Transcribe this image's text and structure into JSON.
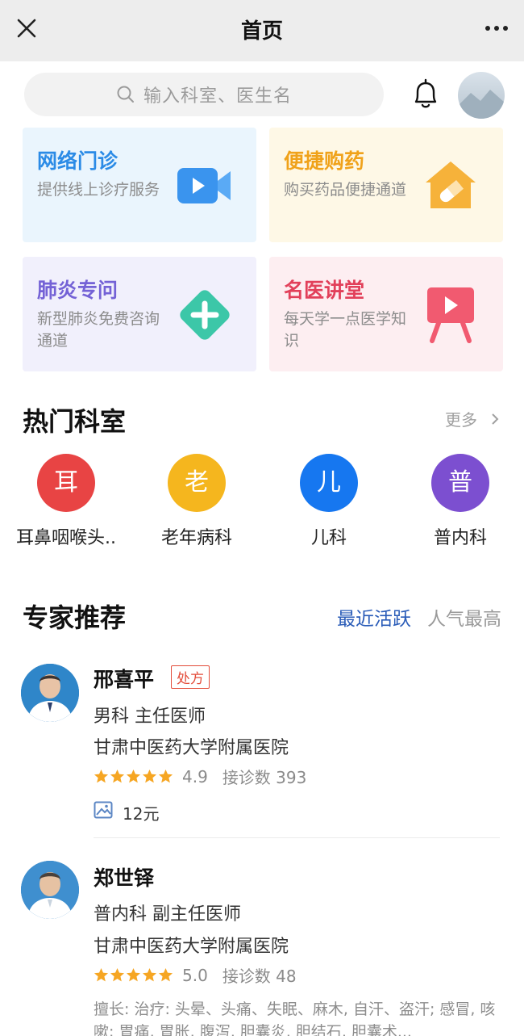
{
  "topbar": {
    "title": "首页",
    "close_icon": "close-icon",
    "more_icon": "more-dots-icon"
  },
  "search": {
    "placeholder": "输入科室、医生名",
    "icon": "search-icon"
  },
  "header_icons": {
    "bell": "bell-icon",
    "avatar": "user-avatar"
  },
  "services": [
    {
      "title": "网络门诊",
      "subtitle": "提供线上诊疗服务",
      "title_color": "#2b8be6",
      "bg": "#eaf5fd",
      "icon": "video-camera-icon"
    },
    {
      "title": "便捷购药",
      "subtitle": "购买药品便捷通道",
      "title_color": "#f0a21a",
      "bg": "#fef8e6",
      "icon": "pill-house-icon"
    },
    {
      "title": "肺炎专问",
      "subtitle": "新型肺炎免费咨询通道",
      "title_color": "#7462d6",
      "bg": "#f1f0fc",
      "icon": "plus-diamond-icon"
    },
    {
      "title": "名医讲堂",
      "subtitle": "每天学一点医学知识",
      "title_color": "#e2405a",
      "bg": "#fdeef1",
      "icon": "easel-play-icon"
    }
  ],
  "hot_departments": {
    "title": "热门科室",
    "more_label": "更多",
    "items": [
      {
        "char": "耳",
        "label": "耳鼻咽喉头..",
        "color": "#e84444"
      },
      {
        "char": "老",
        "label": "老年病科",
        "color": "#f5b61e"
      },
      {
        "char": "儿",
        "label": "儿科",
        "color": "#1677f0"
      },
      {
        "char": "普",
        "label": "普内科",
        "color": "#7c4fd0"
      }
    ]
  },
  "experts": {
    "title": "专家推荐",
    "tabs": [
      {
        "label": "最近活跃",
        "active": true
      },
      {
        "label": "人气最高",
        "active": false
      }
    ],
    "doctors": [
      {
        "name": "邢喜平",
        "badge": "处方",
        "dept_title": "男科  主任医师",
        "hospital": "甘肃中医药大学附属医院",
        "score": "4.9",
        "visits": "接诊数 393",
        "price": "12元"
      },
      {
        "name": "郑世铎",
        "dept_title": "普内科  副主任医师",
        "hospital": "甘肃中医药大学附属医院",
        "score": "5.0",
        "visits": "接诊数 48",
        "skill": "擅长: 治疗: 头晕、头痛、失眠、麻木, 自汗、盗汗; 感冒, 咳嗽; 胃痛, 胃胀, 腹泻, 胆囊炎, 胆结石, 胆囊术..."
      }
    ]
  }
}
